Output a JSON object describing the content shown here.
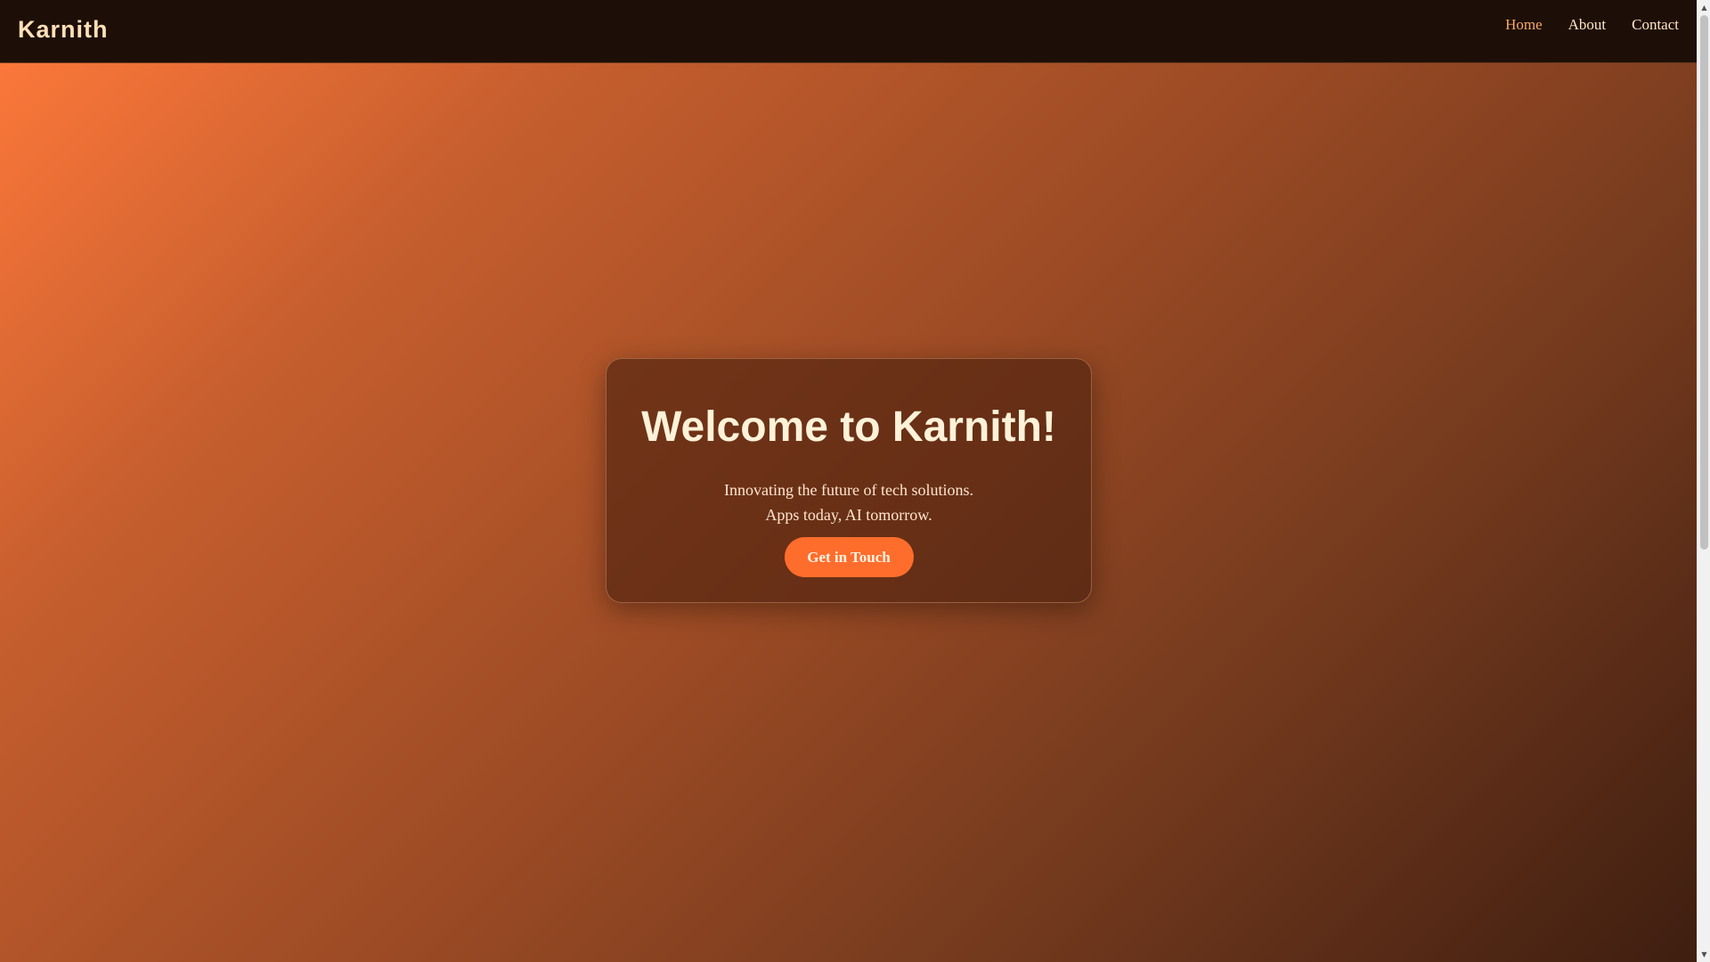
{
  "header": {
    "brand": "Karnith",
    "nav": [
      {
        "label": "Home",
        "active": true
      },
      {
        "label": "About",
        "active": false
      },
      {
        "label": "Contact",
        "active": false
      }
    ]
  },
  "hero": {
    "title": "Welcome to Karnith!",
    "tagline_line1": "Innovating the future of tech solutions.",
    "tagline_line2": "Apps today, AI tomorrow.",
    "cta_label": "Get in Touch"
  },
  "scrollbar": {
    "up_icon": "chevron-up-icon",
    "down_icon": "chevron-down-icon",
    "up_glyph": "▲",
    "down_glyph": "▼"
  },
  "colors": {
    "header_bg": "#1d0f07",
    "brand": "#ffe0b8",
    "nav_active": "#f7a868",
    "gradient_start": "#fb773a",
    "gradient_end": "#3f1e10",
    "cta_bg": "#ff6d2c"
  }
}
